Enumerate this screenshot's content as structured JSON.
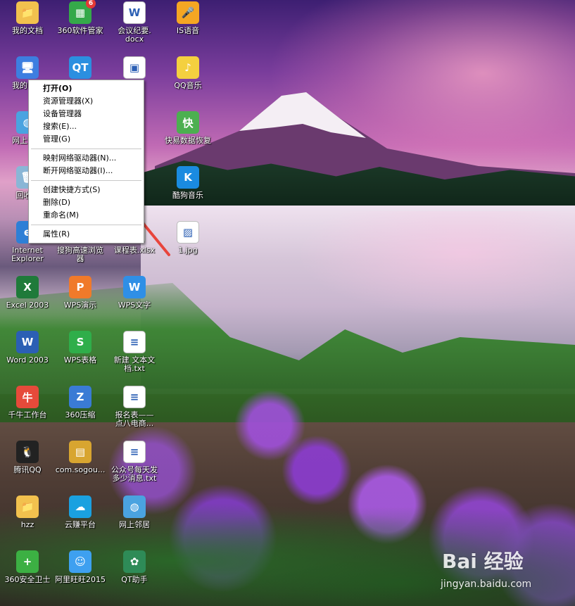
{
  "desktop": {
    "icons": [
      {
        "label": "我的文档",
        "icon": "folder-doc-icon",
        "color": "#f2c14e",
        "glyph": "📁"
      },
      {
        "label": "360软件管家",
        "icon": "app-grid-icon",
        "color": "#35a94a",
        "glyph": "▦",
        "badge": "6"
      },
      {
        "label": "会议纪要.\ndocx",
        "icon": "word-doc-icon",
        "color": "#ffffff",
        "glyph": "W"
      },
      {
        "label": "IS语音",
        "icon": "mic-icon",
        "color": "#f5a623",
        "glyph": "🎤"
      },
      {
        "label": "我的电脑",
        "icon": "computer-icon",
        "color": "#3d7ee0",
        "glyph": "🖥"
      },
      {
        "label": "",
        "icon": "qt-chat-icon",
        "color": "#2b8fe0",
        "glyph": "QT"
      },
      {
        "label": "",
        "icon": "image-file-icon",
        "color": "#ffffff",
        "glyph": "▣"
      },
      {
        "label": "QQ音乐",
        "icon": "music-icon",
        "color": "#f4d03f",
        "glyph": "♪"
      },
      {
        "label": "网上邻居",
        "icon": "network-icon",
        "color": "#4aa3e0",
        "glyph": "◍"
      },
      {
        "label": "快易数据恢复",
        "icon": "recovery-icon",
        "color": "#4caf50",
        "glyph": "快"
      },
      {
        "label": "回收站",
        "icon": "recycle-bin-icon",
        "color": "#8ab6d6",
        "glyph": "🗑"
      },
      {
        "label": "酷狗音乐",
        "icon": "kugou-icon",
        "color": "#1a8be0",
        "glyph": "K"
      },
      {
        "label": "Internet\nExplorer",
        "icon": "ie-browser-icon",
        "color": "#2e7fd6",
        "glyph": "e"
      },
      {
        "label": "搜狗高速浏览\n器",
        "icon": "sogou-browser-icon",
        "color": "#1e88e5",
        "glyph": "S"
      },
      {
        "label": "课程表.xlsx",
        "icon": "excel-file-icon",
        "color": "#ffffff",
        "glyph": "X"
      },
      {
        "label": "1.jpg",
        "icon": "jpg-file-icon",
        "color": "#ffffff",
        "glyph": "▨"
      },
      {
        "label": "Excel 2003",
        "icon": "excel-icon",
        "color": "#1f7a3a",
        "glyph": "X"
      },
      {
        "label": "WPS演示",
        "icon": "wps-present-icon",
        "color": "#f07a2a",
        "glyph": "P"
      },
      {
        "label": "WPS文字",
        "icon": "wps-writer-icon",
        "color": "#2f8fe6",
        "glyph": "W"
      },
      {
        "label": "Word 2003",
        "icon": "word-icon",
        "color": "#2b5fb4",
        "glyph": "W"
      },
      {
        "label": "WPS表格",
        "icon": "wps-sheet-icon",
        "color": "#2fae4a",
        "glyph": "S"
      },
      {
        "label": "新建 文本文\n档.txt",
        "icon": "text-file-icon",
        "color": "#ffffff",
        "glyph": "≡"
      },
      {
        "label": "千牛工作台",
        "icon": "qianniu-icon",
        "color": "#e64a3a",
        "glyph": "牛"
      },
      {
        "label": "360压缩",
        "icon": "zip-icon",
        "color": "#3a7bd5",
        "glyph": "Z"
      },
      {
        "label": "报名表——\n点八电商...",
        "icon": "doc-file-icon",
        "color": "#ffffff",
        "glyph": "≡"
      },
      {
        "label": "腾讯QQ",
        "icon": "qq-penguin-icon",
        "color": "#222222",
        "glyph": "🐧"
      },
      {
        "label": "com.sogou...",
        "icon": "archive-icon",
        "color": "#d8a530",
        "glyph": "▤"
      },
      {
        "label": "公众号每天发\n多少消息.txt",
        "icon": "text-file-icon-2",
        "color": "#ffffff",
        "glyph": "≡"
      },
      {
        "label": "hzz",
        "icon": "folder-icon",
        "color": "#f2c14e",
        "glyph": "📁"
      },
      {
        "label": "云赚平台",
        "icon": "cloud-icon",
        "color": "#1aa1e0",
        "glyph": "☁"
      },
      {
        "label": "网上邻居",
        "icon": "network-icon-2",
        "color": "#4aa3e0",
        "glyph": "◍"
      },
      {
        "label": "360安全卫士",
        "icon": "shield-plus-icon",
        "color": "#3cb043",
        "glyph": "+"
      },
      {
        "label": "阿里旺旺2015",
        "icon": "wangwang-icon",
        "color": "#3ea0f0",
        "glyph": "☺"
      },
      {
        "label": "QT助手",
        "icon": "qt-helper-icon",
        "color": "#2e8b57",
        "glyph": "✿"
      }
    ]
  },
  "context_menu": {
    "groups": [
      [
        {
          "label": "打开(O)",
          "bold": true
        },
        {
          "label": "资源管理器(X)"
        },
        {
          "label": "设备管理器"
        },
        {
          "label": "搜索(E)..."
        },
        {
          "label": "管理(G)"
        }
      ],
      [
        {
          "label": "映射网络驱动器(N)..."
        },
        {
          "label": "断开网络驱动器(I)..."
        }
      ],
      [
        {
          "label": "创建快捷方式(S)"
        },
        {
          "label": "删除(D)"
        },
        {
          "label": "重命名(M)"
        }
      ],
      [
        {
          "label": "属性(R)"
        }
      ]
    ]
  },
  "annotation": {
    "arrow_color": "#e8453c"
  },
  "watermark": {
    "logo": "Bai 经验",
    "url": "jingyan.baidu.com"
  }
}
